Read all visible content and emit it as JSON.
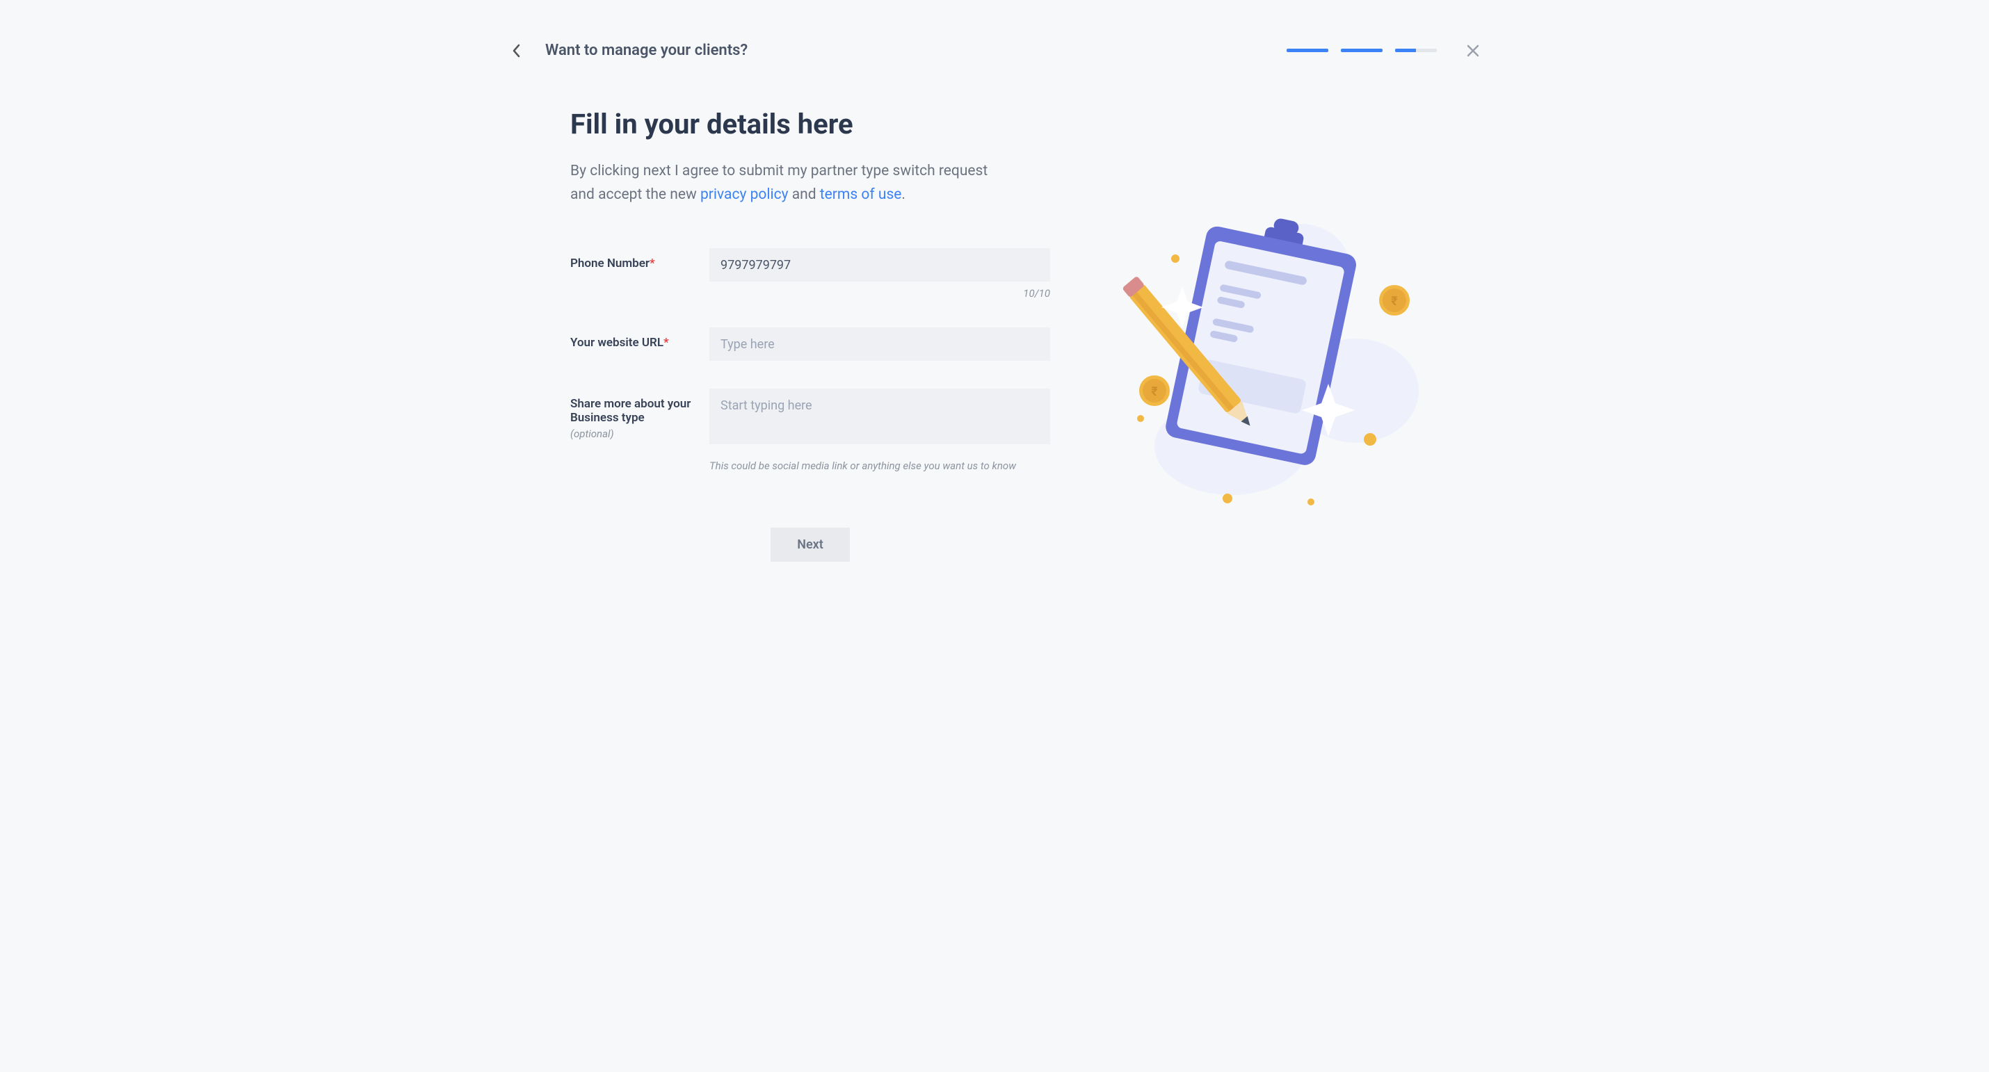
{
  "header": {
    "title": "Want to manage your clients?"
  },
  "main": {
    "heading": "Fill in your details here",
    "consent_prefix": "By clicking next I agree to submit my partner type switch request and accept the new ",
    "privacy_link": "privacy policy",
    "consent_and": " and ",
    "terms_link": "terms of use",
    "consent_suffix": "."
  },
  "form": {
    "phone": {
      "label": "Phone Number",
      "value": "9797979797",
      "counter": "10/10"
    },
    "website": {
      "label": "Your website URL",
      "placeholder": "Type here"
    },
    "business": {
      "label": "Share more about your Business type",
      "optional": "(optional)",
      "placeholder": "Start typing here",
      "helper": "This could be social media link or anything else you want us to know"
    }
  },
  "buttons": {
    "next": "Next"
  }
}
